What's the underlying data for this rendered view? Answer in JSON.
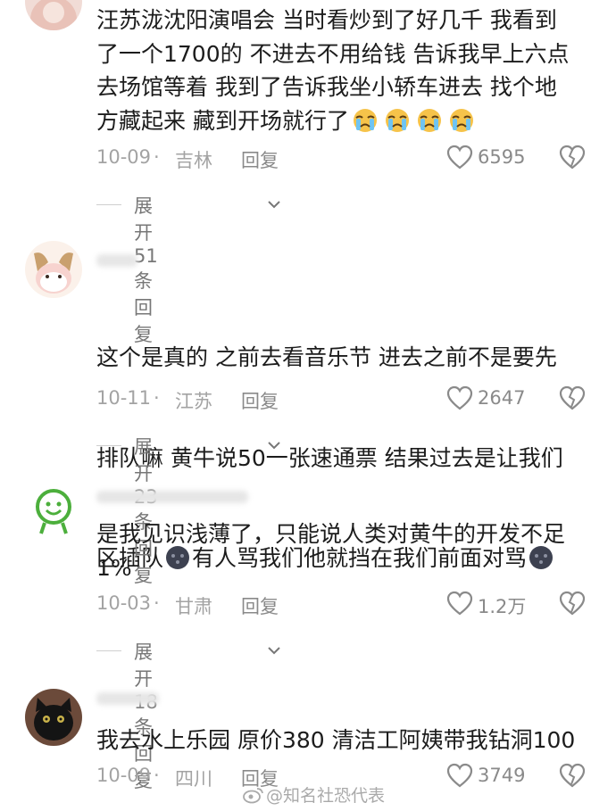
{
  "comments": [
    {
      "text_parts": [
        "汪苏泷沈阳演唱会 当时看炒到了好几千 我看到\n了一个1700的 不进去不用给钱 告诉我早上六点\n去场馆等着 我到了告诉我坐小轿车进去 找个地\n方藏起来 藏到开场就行了"
      ],
      "emojis": [
        "crying-face",
        "crying-face",
        "crying-face",
        "crying-face"
      ],
      "date": "10-09",
      "separator": "·",
      "location": "吉林",
      "reply_label": "回复",
      "likes": "6595",
      "expand_label": "展开51条回复"
    },
    {
      "text_line1": "这个是真的 之前去看音乐节 进去之前不是要先",
      "text_line2": "排队嘛 黄牛说50一张速通票 结果过去是让我们",
      "text_line3a": "区插队",
      "text_line3b": "有人骂我们他就挡在我们前面对骂",
      "emojis": [
        "dark-face",
        "dark-face"
      ],
      "date": "10-11",
      "separator": "·",
      "location": "江苏",
      "reply_label": "回复",
      "likes": "2647",
      "expand_label": "展开23条回复"
    },
    {
      "text": "是我见识浅薄了，只能说人类对黄牛的开发不足\n1%",
      "date": "10-03",
      "separator": "·",
      "location": "甘肃",
      "reply_label": "回复",
      "likes": "1.2万",
      "expand_label": "展开18条回复"
    },
    {
      "text": "我去水上乐园 原价380 清洁工阿姨带我钻洞100",
      "date": "10-09",
      "separator": "·",
      "location": "四川",
      "reply_label": "回复",
      "likes": "3749"
    }
  ],
  "watermark": "@知名社恐代表",
  "icons": {
    "like": "heart-outline-icon",
    "dislike": "broken-heart-icon",
    "expand": "chevron-down-icon"
  },
  "colors": {
    "text": "#1c1c1c",
    "meta": "#a3a3a3",
    "background": "#ffffff"
  }
}
